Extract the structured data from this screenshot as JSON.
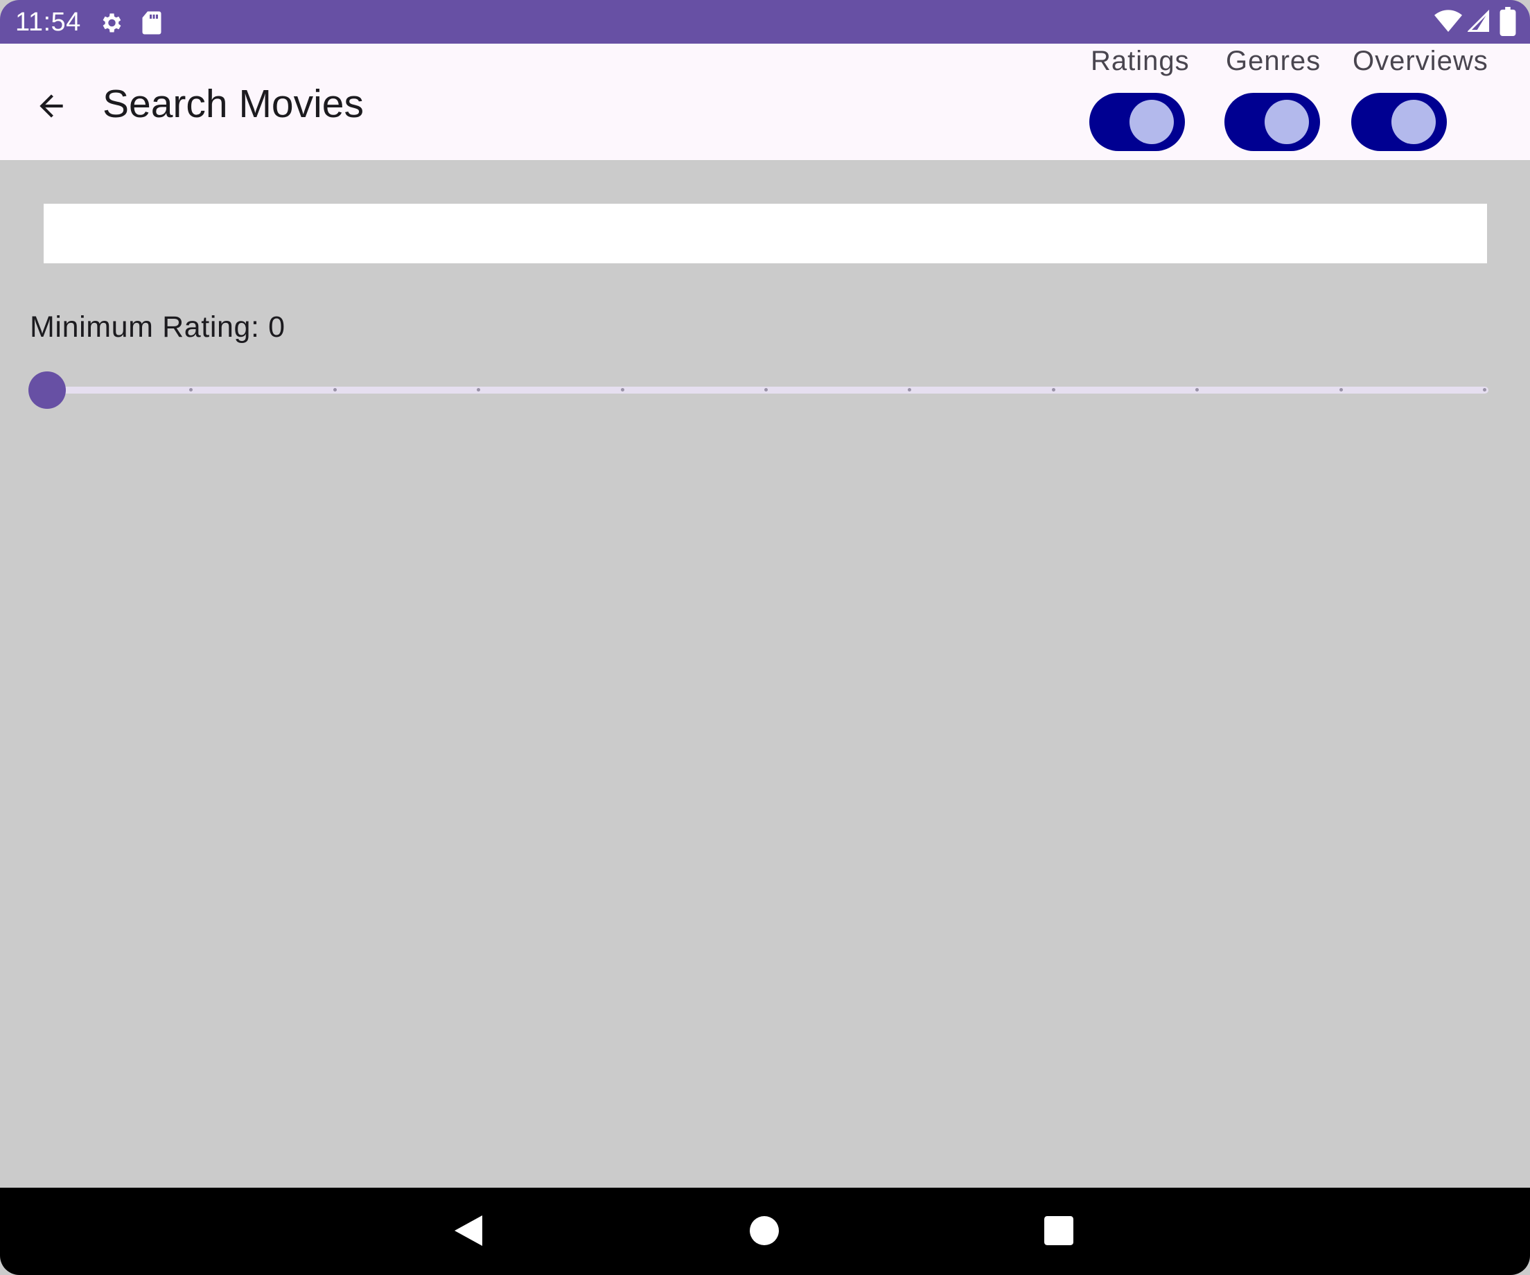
{
  "status_bar": {
    "time": "11:54",
    "left_icons": [
      "gear-icon",
      "sd-card-icon"
    ],
    "right_icons": [
      "wifi-icon",
      "signal-icon",
      "battery-icon"
    ],
    "color": "#6750a4"
  },
  "app_bar": {
    "title": "Search Movies",
    "back_icon": "arrow-back-icon",
    "toggles": [
      {
        "label": "Ratings",
        "checked": true
      },
      {
        "label": "Genres",
        "checked": true
      },
      {
        "label": "Overviews",
        "checked": true
      }
    ],
    "switch_track_color": "#000091",
    "switch_thumb_color": "#b3b9ec"
  },
  "search": {
    "value": "",
    "placeholder": ""
  },
  "rating_filter": {
    "label": "Minimum Rating:",
    "value": "0",
    "min": 0,
    "max": 10,
    "step": 1,
    "accent": "#6750a4"
  },
  "nav_bar": {
    "buttons": [
      "back-triangle-icon",
      "home-circle-icon",
      "recents-square-icon"
    ]
  }
}
